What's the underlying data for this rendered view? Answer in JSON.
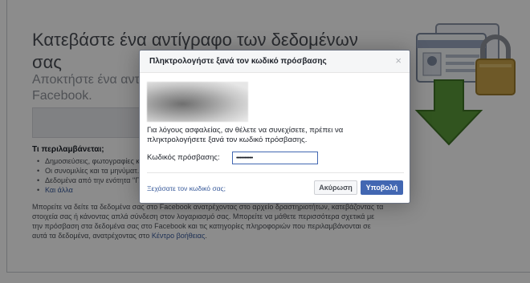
{
  "background": {
    "title": "Κατεβάστε ένα αντίγραφο των δεδομένων σας",
    "subtitle": "Αποκτήστε ένα αντίγ... Facebook.",
    "includes_heading": "Τι περιλαμβάνεται;",
    "includes_items": [
      "Δημοσιεύσεις, φωτογραφίες κ...",
      "Οι συνομιλίες και τα μηνύματ...",
      "Δεδομένα από την ενότητα \"Γ...",
      "Και άλλα"
    ],
    "paragraph": "Μπορείτε να δείτε τα δεδομένα σας στο Facebook ανατρέχοντας στο αρχείο δραστηριοτήτων, κατεβάζοντας τα στοιχεία σας ή κάνοντας απλά σύνδεση στον λογαριασμό σας. Μπορείτε να μάθετε περισσότερα σχετικά με την πρόσβαση στα δεδομένα σας στο Facebook και τις κατηγορίες πληροφοριών που περιλαμβάνονται σε αυτά τα δεδομένα, ανατρέχοντας στο",
    "help_link": "Κέντρο βοήθειας",
    "paragraph_end": "."
  },
  "dialog": {
    "title": "Πληκτρολογήστε ξανά τον κωδικό πρόσβασης",
    "close_glyph": "×",
    "message": "Για λόγους ασφαλείας, αν θέλετε να συνεχίσετε, πρέπει να πληκτρολογήσετε ξανά τον κωδικό πρόσβασης.",
    "password_label": "Κωδικός πρόσβασης:",
    "password_value": "••••••••••••••",
    "forgot_link": "Ξεχάσατε τον κωδικό σας;",
    "cancel_label": "Ακύρωση",
    "submit_label": "Υποβολή"
  },
  "colors": {
    "accent": "#4267b2",
    "link": "#365899",
    "illustration_green": "#5a9a3a",
    "illustration_gold": "#c9a24a"
  }
}
